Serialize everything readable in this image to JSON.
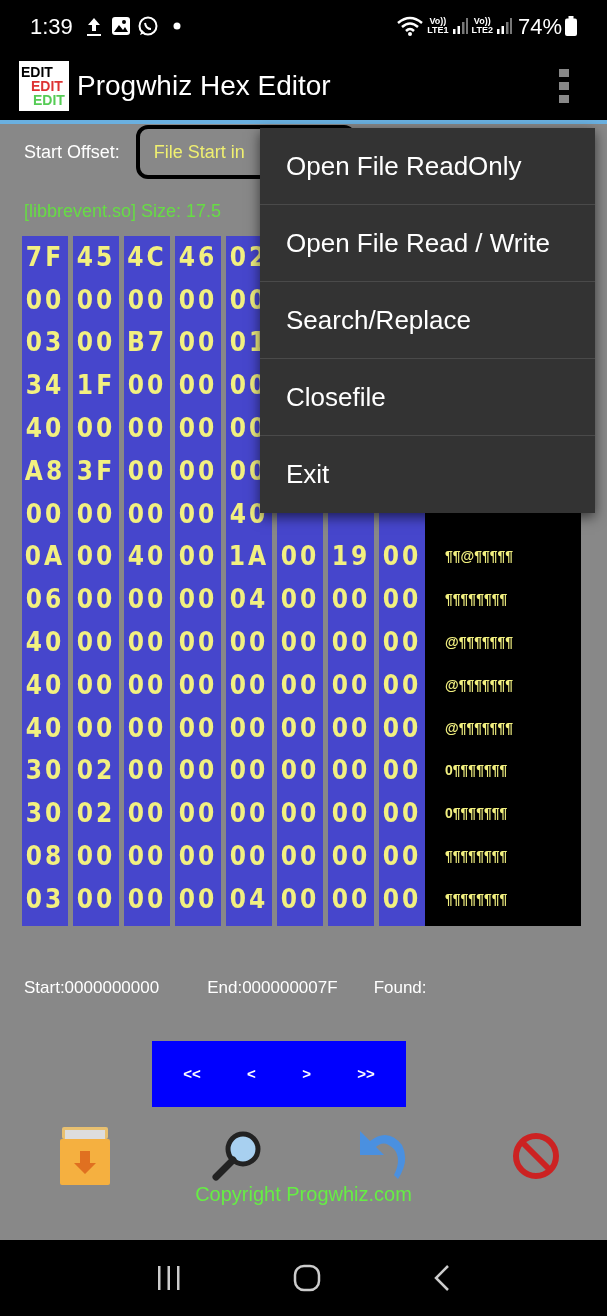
{
  "status_bar": {
    "time": "1:39",
    "sims": [
      {
        "top": "Vo))",
        "bottom": "LTE1"
      },
      {
        "top": "Vo))",
        "bottom": "LTE2"
      }
    ],
    "battery": "74%"
  },
  "app_bar": {
    "logo_texts": [
      "EDIT",
      "EDIT",
      "EDIT"
    ],
    "title": "Progwhiz Hex Editor"
  },
  "start_offset": {
    "label": "Start Offset:",
    "value": "File Start in"
  },
  "file_info": "[libbrevent.so] Size: 17.5",
  "hex_rows": [
    {
      "bytes": [
        "7F",
        "45",
        "4C",
        "46",
        "02"
      ]
    },
    {
      "bytes": [
        "00",
        "00",
        "00",
        "00",
        "00"
      ]
    },
    {
      "bytes": [
        "03",
        "00",
        "B7",
        "00",
        "01"
      ]
    },
    {
      "bytes": [
        "34",
        "1F",
        "00",
        "00",
        "00"
      ]
    },
    {
      "bytes": [
        "40",
        "00",
        "00",
        "00",
        "00"
      ]
    },
    {
      "bytes": [
        "A8",
        "3F",
        "00",
        "00",
        "00"
      ]
    },
    {
      "bytes": [
        "00",
        "00",
        "00",
        "00",
        "40"
      ]
    },
    {
      "bytes": [
        "0A",
        "00",
        "40",
        "00",
        "1A",
        "00",
        "19",
        "00"
      ],
      "ascii": "¶¶@¶¶¶¶¶"
    },
    {
      "bytes": [
        "06",
        "00",
        "00",
        "00",
        "04",
        "00",
        "00",
        "00"
      ],
      "ascii": "¶¶¶¶¶¶¶¶"
    },
    {
      "bytes": [
        "40",
        "00",
        "00",
        "00",
        "00",
        "00",
        "00",
        "00"
      ],
      "ascii": "@¶¶¶¶¶¶¶"
    },
    {
      "bytes": [
        "40",
        "00",
        "00",
        "00",
        "00",
        "00",
        "00",
        "00"
      ],
      "ascii": "@¶¶¶¶¶¶¶"
    },
    {
      "bytes": [
        "40",
        "00",
        "00",
        "00",
        "00",
        "00",
        "00",
        "00"
      ],
      "ascii": "@¶¶¶¶¶¶¶"
    },
    {
      "bytes": [
        "30",
        "02",
        "00",
        "00",
        "00",
        "00",
        "00",
        "00"
      ],
      "ascii": "0¶¶¶¶¶¶¶"
    },
    {
      "bytes": [
        "30",
        "02",
        "00",
        "00",
        "00",
        "00",
        "00",
        "00"
      ],
      "ascii": "0¶¶¶¶¶¶¶"
    },
    {
      "bytes": [
        "08",
        "00",
        "00",
        "00",
        "00",
        "00",
        "00",
        "00"
      ],
      "ascii": "¶¶¶¶¶¶¶¶"
    },
    {
      "bytes": [
        "03",
        "00",
        "00",
        "00",
        "04",
        "00",
        "00",
        "00"
      ],
      "ascii": "¶¶¶¶¶¶¶¶"
    }
  ],
  "range": {
    "start": "Start:0000000000",
    "end": "End:000000007F",
    "found": "Found:"
  },
  "page_buttons": [
    "<<",
    "<",
    ">",
    ">>"
  ],
  "copyright": "Copyright Progwhiz.com",
  "menu": {
    "items": [
      "Open File ReadOnly",
      "Open File Read / Write",
      "Search/Replace",
      "Closefile",
      "Exit"
    ]
  }
}
